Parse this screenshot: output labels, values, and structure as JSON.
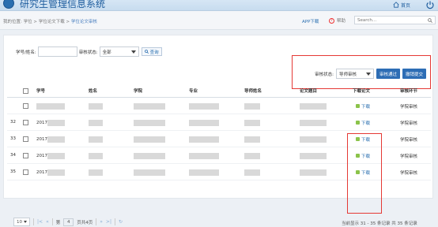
{
  "app": {
    "title": "研究生管理信息系统",
    "home_label": "首页"
  },
  "breadcrumb": {
    "prefix": "我的位置",
    "items": [
      "学位",
      "学位论文下载",
      "学位论文审核"
    ]
  },
  "navbar": {
    "apps_label": "APP下载",
    "help_label": "帮助",
    "search_placeholder": "Search..."
  },
  "filters": {
    "student_label": "学号/姓名:",
    "status_label": "审核状态:",
    "status_value": "全部",
    "query_label": "查询"
  },
  "actions": {
    "review_status_label": "审核状态:",
    "review_status_value": "导师审核",
    "approve_label": "审核通过",
    "revoke_label": "撤销提交"
  },
  "table": {
    "headers": [
      "学号",
      "姓名",
      "学院",
      "专业",
      "导师姓名",
      "论文题目",
      "下载论文",
      "审核环节"
    ],
    "rows": [
      {
        "num": "",
        "id_prefix": "",
        "download": "下载",
        "stage": "学院审核"
      },
      {
        "num": "32",
        "id_prefix": "2017",
        "download": "下载",
        "stage": "学院审核"
      },
      {
        "num": "33",
        "id_prefix": "2017",
        "download": "下载",
        "stage": "学院审核"
      },
      {
        "num": "34",
        "id_prefix": "2017",
        "download": "下载",
        "stage": "学院审核"
      },
      {
        "num": "35",
        "id_prefix": "2017",
        "download": "下载",
        "stage": "学院审核"
      }
    ]
  },
  "pager": {
    "page_size": "10",
    "page_label": "第",
    "page_value": "4",
    "total_pages": "页共4页",
    "record_info": "当前显示 31 - 35 条记录 共 35 条记录"
  },
  "colors": {
    "accent": "#2d6db5",
    "highlight": "#e53935",
    "title": "#1e5d9e"
  },
  "icons": [
    "logo-icon",
    "home-icon",
    "power-icon",
    "help-icon",
    "search-icon",
    "query-search-icon",
    "download-icon",
    "first-page-icon",
    "prev-page-icon",
    "next-page-icon",
    "last-page-icon",
    "refresh-icon"
  ]
}
